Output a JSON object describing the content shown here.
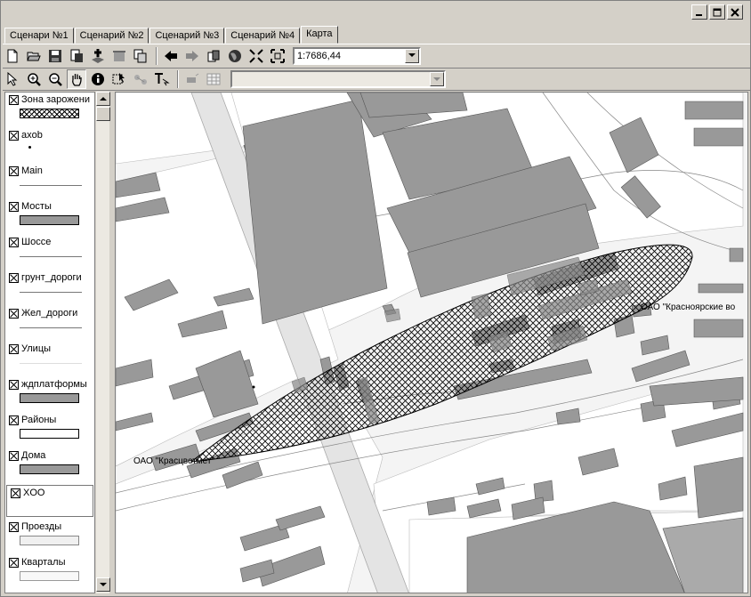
{
  "window": {
    "controls": [
      "minimize",
      "maximize",
      "close"
    ]
  },
  "tabs": [
    {
      "label": "Сценари №1",
      "active": false
    },
    {
      "label": "Сценарий №2",
      "active": false
    },
    {
      "label": "Сценарий №3",
      "active": false
    },
    {
      "label": "Сценарий №4",
      "active": false
    },
    {
      "label": "Карта",
      "active": true
    }
  ],
  "toolbar1": {
    "icons": [
      "new-file-icon",
      "open-folder-icon",
      "save-icon",
      "export-icon",
      "add-layer-icon",
      "remove-layer-icon",
      "copy-icon",
      "back-arrow-icon",
      "forward-arrow-icon",
      "print-preview-icon",
      "globe-icon",
      "zoom-extent-icon",
      "full-extent-icon"
    ],
    "scale_value": "1:7686,44"
  },
  "toolbar2": {
    "icons": [
      "pointer-icon",
      "zoom-in-icon",
      "zoom-out-icon",
      "pan-hand-icon",
      "info-icon",
      "select-area-icon",
      "measure-icon",
      "text-tool-icon",
      "disabled-tool-icon",
      "table-icon"
    ],
    "combo_value": ""
  },
  "legend": {
    "items": [
      {
        "label": "Зона зарожени",
        "swatch": "hatch"
      },
      {
        "label": "axob",
        "swatch": "dot"
      },
      {
        "label": "Main",
        "swatch": "line"
      },
      {
        "label": "Мосты",
        "swatch": "fill",
        "color": "#999999"
      },
      {
        "label": "Шоссе",
        "swatch": "line"
      },
      {
        "label": "грунт_дороги",
        "swatch": "line"
      },
      {
        "label": "Жел_дороги",
        "swatch": "line"
      },
      {
        "label": "Улицы",
        "swatch": "line"
      },
      {
        "label": "ждплатформы",
        "swatch": "fill",
        "color": "#999999"
      },
      {
        "label": "Районы",
        "swatch": "fill",
        "color": "#ffffff"
      },
      {
        "label": "Дома",
        "swatch": "fill",
        "color": "#999999"
      },
      {
        "label": "XOO",
        "swatch": "none"
      },
      {
        "label": "Проезды",
        "swatch": "fill",
        "color": "#f0f0f0"
      },
      {
        "label": "Кварталы",
        "swatch": "fill",
        "color": "#f8f8f8"
      }
    ]
  },
  "map": {
    "labels": [
      {
        "text": "ОАО \"Красцветмет\""
      },
      {
        "text": "ОАО \"Красноярские во"
      }
    ],
    "colors": {
      "building": "#999999",
      "street": "#f4f4f4",
      "block": "#ffffff",
      "road": "#e0e0e0"
    }
  }
}
